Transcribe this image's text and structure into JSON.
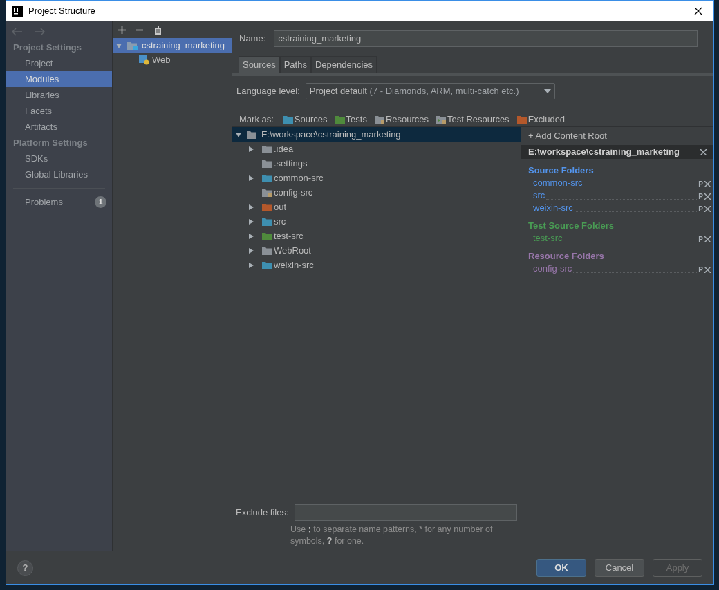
{
  "window": {
    "title": "Project Structure"
  },
  "nav": {
    "sections": [
      {
        "title": "Project Settings",
        "items": [
          {
            "label": "Project",
            "selected": false
          },
          {
            "label": "Modules",
            "selected": true
          },
          {
            "label": "Libraries",
            "selected": false
          },
          {
            "label": "Facets",
            "selected": false
          },
          {
            "label": "Artifacts",
            "selected": false
          }
        ]
      },
      {
        "title": "Platform Settings",
        "items": [
          {
            "label": "SDKs",
            "selected": false
          },
          {
            "label": "Global Libraries",
            "selected": false
          }
        ]
      }
    ],
    "problems": {
      "label": "Problems",
      "count": "1"
    }
  },
  "modules": [
    {
      "label": "cstraining_marketing",
      "selected": true,
      "expanded": true,
      "children": [
        {
          "label": "Web",
          "selected": false
        }
      ]
    }
  ],
  "name_field": {
    "label": "Name:",
    "value": "cstraining_marketing"
  },
  "tabs": [
    {
      "label": "Sources",
      "selected": true
    },
    {
      "label": "Paths",
      "selected": false
    },
    {
      "label": "Dependencies",
      "selected": false
    }
  ],
  "language_level": {
    "label": "Language level:",
    "value": "Project default",
    "detail": "(7 - Diamonds, ARM, multi-catch etc.)"
  },
  "mark_as": {
    "label": "Mark as:",
    "items": [
      {
        "label": "Sources",
        "kind": "source"
      },
      {
        "label": "Tests",
        "kind": "test"
      },
      {
        "label": "Resources",
        "kind": "resource"
      },
      {
        "label": "Test Resources",
        "kind": "test_resource"
      },
      {
        "label": "Excluded",
        "kind": "excluded"
      }
    ]
  },
  "file_tree": {
    "root": {
      "label": "E:\\workspace\\cstraining_marketing",
      "expanded": true,
      "selected": true
    },
    "children": [
      {
        "label": ".idea",
        "kind": "plain",
        "expandable": true
      },
      {
        "label": ".settings",
        "kind": "plain",
        "expandable": false
      },
      {
        "label": "common-src",
        "kind": "source",
        "expandable": true
      },
      {
        "label": "config-src",
        "kind": "resource",
        "expandable": false
      },
      {
        "label": "out",
        "kind": "excluded",
        "expandable": true
      },
      {
        "label": "src",
        "kind": "source",
        "expandable": true
      },
      {
        "label": "test-src",
        "kind": "test",
        "expandable": true
      },
      {
        "label": "WebRoot",
        "kind": "plain",
        "expandable": true
      },
      {
        "label": "weixin-src",
        "kind": "source",
        "expandable": true
      }
    ]
  },
  "exclude_files": {
    "label": "Exclude files:",
    "hint": [
      {
        "text": "Use ",
        "bold": false
      },
      {
        "text": ";",
        "bold": true
      },
      {
        "text": " to separate name patterns, * for any number of symbols, ",
        "bold": false
      },
      {
        "text": "?",
        "bold": true
      },
      {
        "text": " for one.",
        "bold": false
      }
    ]
  },
  "content_roots": {
    "add_label": "+ Add Content Root",
    "root": "E:\\workspace\\cstraining_marketing",
    "sections": [
      {
        "title": "Source Folders",
        "color": "#5394ec",
        "folders": [
          {
            "name": "common-src",
            "prefix": "P"
          },
          {
            "name": "src",
            "prefix": "P"
          },
          {
            "name": "weixin-src",
            "prefix": "P"
          }
        ]
      },
      {
        "title": "Test Source Folders",
        "color": "#499c54",
        "folders": [
          {
            "name": "test-src",
            "prefix": "P"
          }
        ]
      },
      {
        "title": "Resource Folders",
        "color": "#9876aa",
        "folders": [
          {
            "name": "config-src",
            "prefix": "P"
          }
        ]
      }
    ]
  },
  "help": "?",
  "buttons": [
    {
      "label": "OK",
      "default": true,
      "disabled": false
    },
    {
      "label": "Cancel",
      "default": false,
      "disabled": false
    },
    {
      "label": "Apply",
      "default": false,
      "disabled": true
    }
  ]
}
